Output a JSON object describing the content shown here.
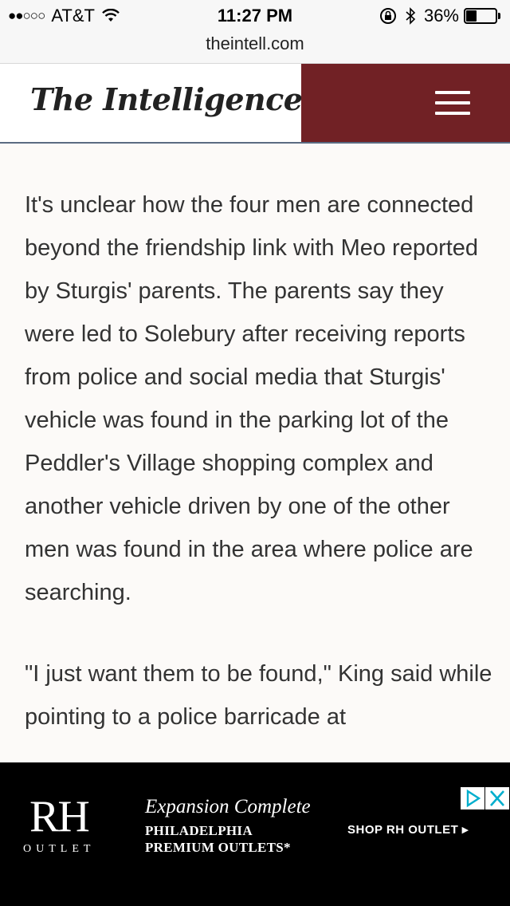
{
  "status_bar": {
    "signal": "●●○○○",
    "carrier": "AT&T",
    "time": "11:27 PM",
    "battery_percent": "36%",
    "battery_level": 0.36
  },
  "browser": {
    "url": "theintell.com"
  },
  "header": {
    "logo_text": "The Intelligencer",
    "brand_color": "#712125"
  },
  "article": {
    "paragraphs": [
      "It's unclear how the four men are connected beyond the friendship link with Meo reported by Sturgis' parents. The parents say they were led to Solebury after receiving reports from police and social media that Sturgis' vehicle was found in the parking lot of the Peddler's Village shopping complex and another vehicle driven by one of the other men was found in the area where police are searching.",
      "\"I just want them to be found,\" King said while pointing to a police barricade at"
    ]
  },
  "ad": {
    "logo": "RH",
    "logo_sub": "OUTLET",
    "headline": "Expansion Complete",
    "line2": "PHILADELPHIA",
    "line3": "PREMIUM OUTLETS*",
    "cta": "SHOP RH OUTLET ▸"
  }
}
